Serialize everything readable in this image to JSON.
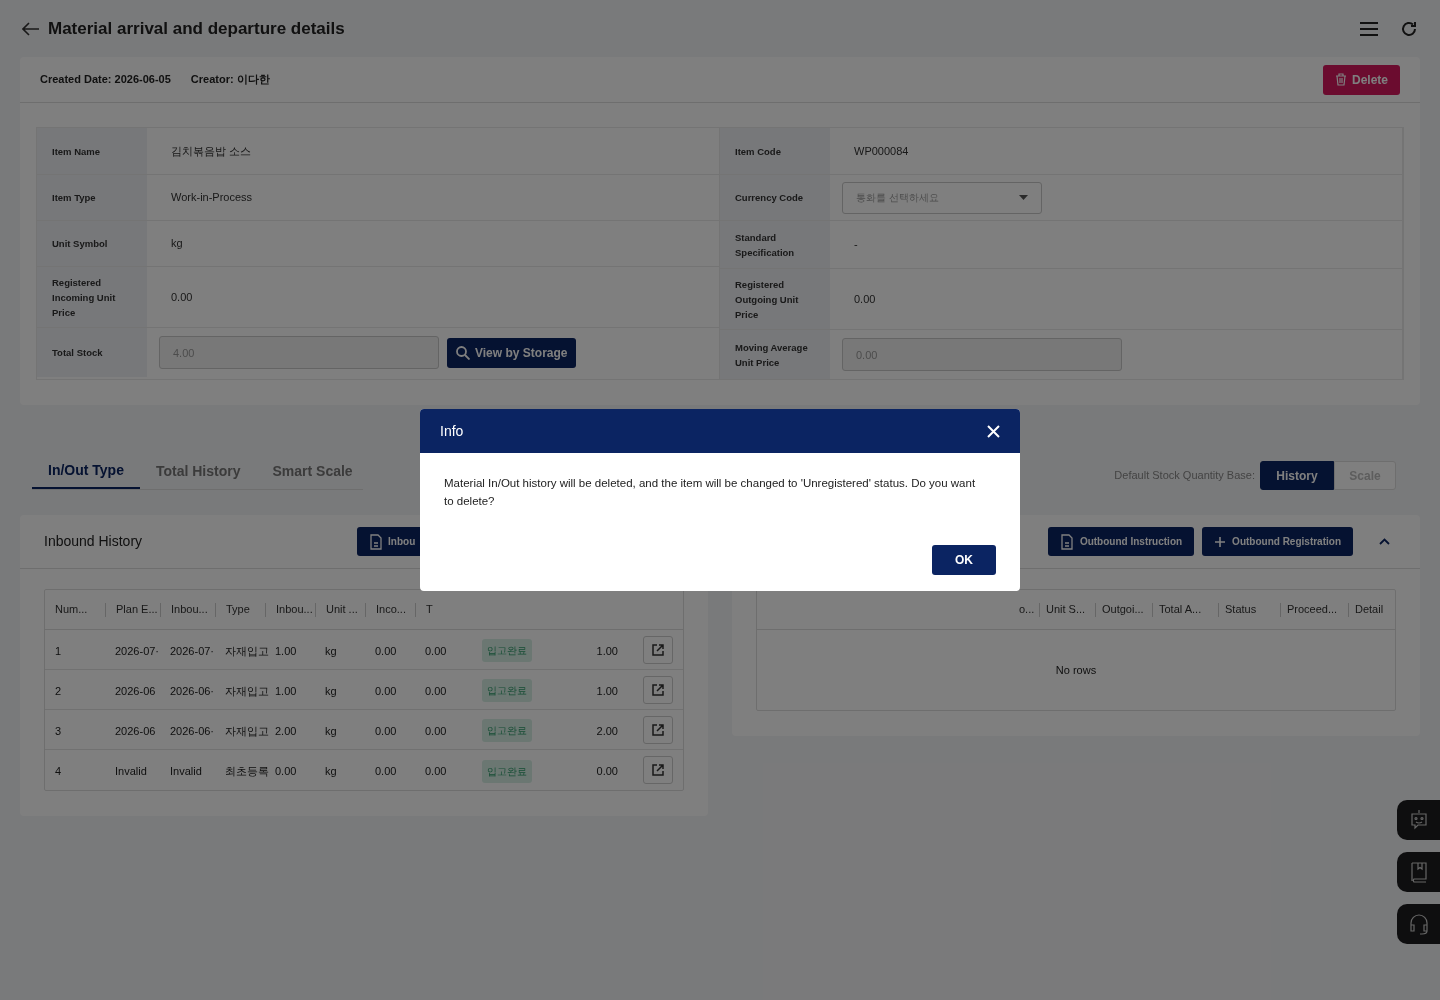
{
  "header": {
    "title": "Material arrival and departure details"
  },
  "meta": {
    "created": "Created Date: 2026-06-05",
    "creator": "Creator: 이다한",
    "delete_button": "Delete"
  },
  "details": {
    "left": [
      {
        "label": "Item Name",
        "value": "김치볶음밥 소스",
        "kind": "text"
      },
      {
        "label": "Item Type",
        "value": "Work-in-Process",
        "kind": "text"
      },
      {
        "label": "Unit Symbol",
        "value": "kg",
        "kind": "text"
      },
      {
        "label": "Registered Incoming Unit Price",
        "value": "0.00",
        "kind": "text"
      },
      {
        "label": "Total Stock",
        "value": "4.00",
        "kind": "input",
        "button": "View by Storage"
      }
    ],
    "right": [
      {
        "label": "Item Code",
        "value": "WP000084",
        "kind": "text"
      },
      {
        "label": "Currency Code",
        "placeholder": "통화를 선택하세요",
        "kind": "select"
      },
      {
        "label": "Standard Specification",
        "value": "-",
        "kind": "text"
      },
      {
        "label": "Registered Outgoing Unit Price",
        "value": "0.00",
        "kind": "text"
      },
      {
        "label": "Moving Average Unit Price",
        "value": "0.00",
        "kind": "input"
      }
    ]
  },
  "tabs": [
    {
      "label": "In/Out Type",
      "selected": true
    },
    {
      "label": "Total History",
      "selected": false
    },
    {
      "label": "Smart Scale",
      "selected": false
    }
  ],
  "stock_base": {
    "label": "Default Stock Quantity Base:",
    "options": [
      {
        "label": "History",
        "selected": true
      },
      {
        "label": "Scale",
        "selected": false
      }
    ]
  },
  "inbound": {
    "title": "Inbound History",
    "button": "Inbou",
    "columns": [
      "Num...",
      "Plan E...",
      "Inbou...",
      "Type",
      "Inbou...",
      "Unit ...",
      "Inco...",
      "T"
    ],
    "rows": [
      {
        "cells": [
          "1",
          "2026-07·",
          "2026-07·",
          "자재입고",
          "1.00",
          "kg",
          "0.00",
          "0.00"
        ],
        "status": "입고완료",
        "column_10": "1.00"
      },
      {
        "cells": [
          "2",
          "2026-06",
          "2026-06·",
          "자재입고",
          "1.00",
          "kg",
          "0.00",
          "0.00"
        ],
        "status": "입고완료",
        "column_10": "1.00"
      },
      {
        "cells": [
          "3",
          "2026-06",
          "2026-06·",
          "자재입고",
          "2.00",
          "kg",
          "0.00",
          "0.00"
        ],
        "status": "입고완료",
        "column_10": "2.00"
      },
      {
        "cells": [
          "4",
          "Invalid",
          "Invalid",
          "최초등록",
          "0.00",
          "kg",
          "0.00",
          "0.00"
        ],
        "status": "입고완료",
        "column_10": "0.00"
      }
    ]
  },
  "outbound": {
    "buttons": [
      {
        "label": "Outbound Instruction",
        "kind": "doc"
      },
      {
        "label": "Outbound Registration",
        "kind": "plus"
      }
    ],
    "columns": [
      "o...",
      "Unit S...",
      "Outgoi...",
      "Total A...",
      "Status",
      "Proceed...",
      "Detail"
    ],
    "empty": "No rows"
  },
  "dialog": {
    "title": "Info",
    "message": "Material In/Out history will be deleted, and the item will be changed to 'Unregistered' status. Do you want to delete?",
    "ok": "OK"
  }
}
